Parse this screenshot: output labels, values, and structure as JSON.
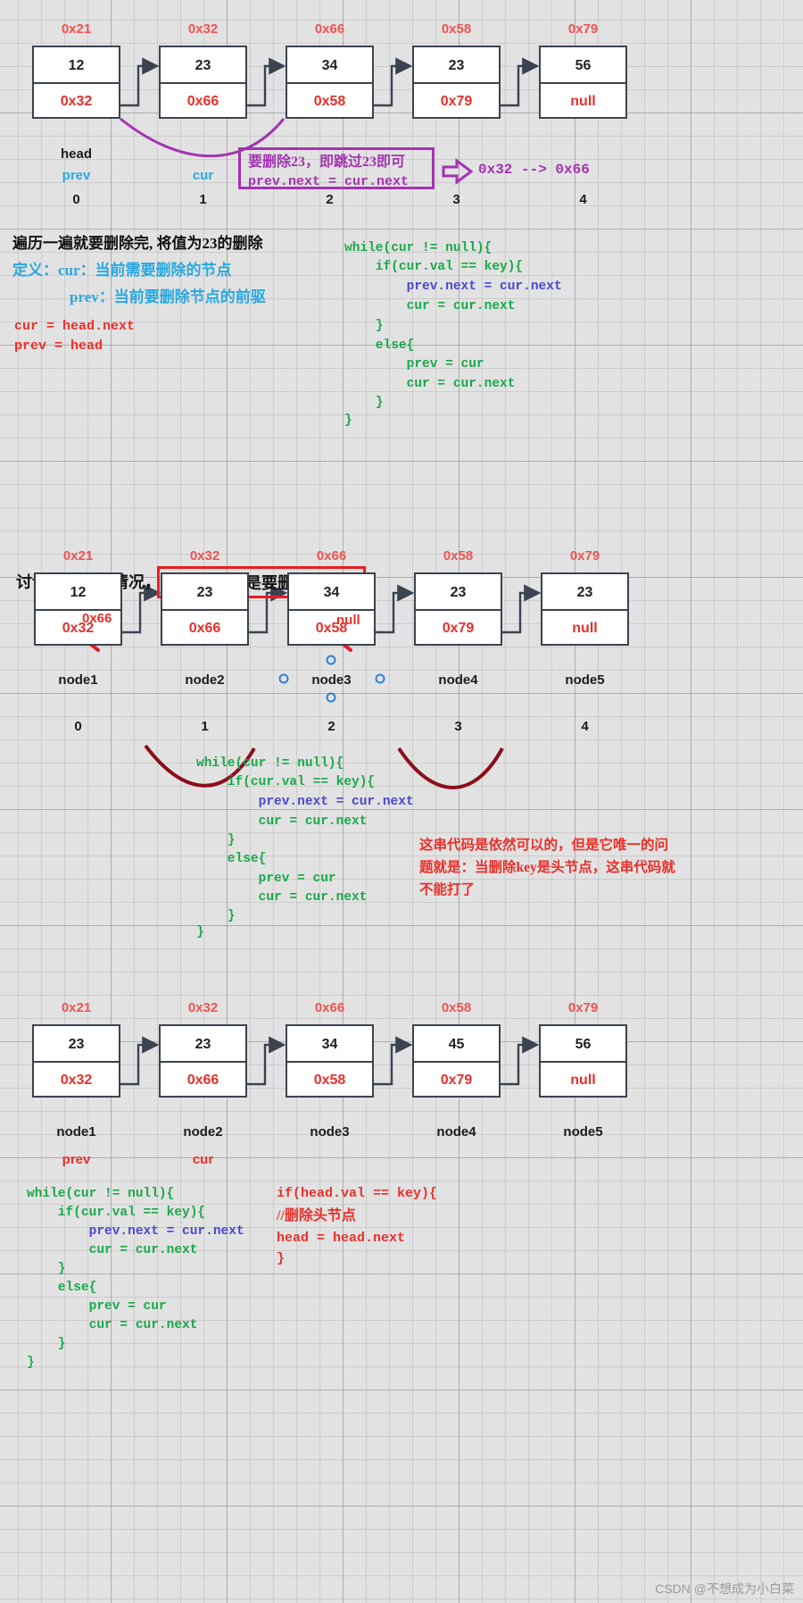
{
  "section1": {
    "addresses": [
      "0x21",
      "0x32",
      "0x66",
      "0x58",
      "0x79"
    ],
    "values": [
      "12",
      "23",
      "34",
      "23",
      "56"
    ],
    "pointers": [
      "0x32",
      "0x66",
      "0x58",
      "0x79",
      "null"
    ],
    "labels": [
      "head",
      "",
      "",
      "",
      ""
    ],
    "pointer_labels": [
      "prev",
      "",
      "cur",
      "",
      ""
    ],
    "indices": [
      "0",
      "1",
      "2",
      "3",
      "4"
    ],
    "callout_line1": "要删除23，即跳过23即可",
    "callout_line2": "prev.next = cur.next",
    "callout_result": "0x32 --> 0x66"
  },
  "explain1": {
    "title": "遍历一遍就要删除完, 将值为23的删除",
    "def_line1": "定义：cur：当前需要删除的节点",
    "def_line2": "prev：当前要删除节点的前驱",
    "init_line1": "cur = head.next",
    "init_line2": "prev = head"
  },
  "code1": {
    "lines": [
      "while(cur != null){",
      "    if(cur.val == key){",
      "        prev.next = cur.next",
      "        cur = cur.next",
      "    }",
      "    else{",
      "        prev = cur",
      "        cur = cur.next",
      "    }",
      "}"
    ],
    "highlight_line_index": 2
  },
  "section2": {
    "heading_prefix": "讨论另外一种情况，",
    "heading_boxed": "尾巴节点也是要删除的节点",
    "addresses": [
      "0x21",
      "0x32",
      "0x66",
      "0x58",
      "0x79"
    ],
    "values": [
      "12",
      "23",
      "34",
      "23",
      "23"
    ],
    "pointers": [
      "0x32",
      "0x66",
      "0x58",
      "0x79",
      "null"
    ],
    "strike_replacements": [
      "0x66",
      "",
      "null",
      "",
      ""
    ],
    "node_labels": [
      "node1",
      "node2",
      "node3",
      "node4",
      "node5"
    ],
    "indices": [
      "0",
      "1",
      "2",
      "3",
      "4"
    ]
  },
  "code2": {
    "lines": [
      "while(cur != null){",
      "    if(cur.val == key){",
      "        prev.next = cur.next",
      "        cur = cur.next",
      "    }",
      "    else{",
      "        prev = cur",
      "        cur = cur.next",
      "    }",
      "}"
    ],
    "highlight_line_index": 2,
    "note": "这串代码是依然可以的，但是它唯一的问题就是：当删除key是头节点，这串代码就不能打了"
  },
  "section3": {
    "addresses": [
      "0x21",
      "0x32",
      "0x66",
      "0x58",
      "0x79"
    ],
    "values": [
      "23",
      "23",
      "34",
      "45",
      "56"
    ],
    "pointers": [
      "0x32",
      "0x66",
      "0x58",
      "0x79",
      "null"
    ],
    "node_labels": [
      "node1",
      "node2",
      "node3",
      "node4",
      "node5"
    ],
    "pointer_labels": [
      "prev",
      "cur",
      "",
      "",
      ""
    ]
  },
  "code3": {
    "lines": [
      "while(cur != null){",
      "    if(cur.val == key){",
      "        prev.next = cur.next",
      "        cur = cur.next",
      "    }",
      "    else{",
      "        prev = cur",
      "        cur = cur.next",
      "    }",
      "}"
    ],
    "highlight_line_index": 2
  },
  "code4": {
    "lines": [
      "if(head.val == key){",
      "//删除头节点",
      "head = head.next",
      "}"
    ]
  },
  "watermark": "CSDN @不想成为小白菜",
  "colors": {
    "address_red": "#ef5350",
    "pointer_red": "#e8302a",
    "blue": "#29a8e0",
    "purple": "#a333b0",
    "green": "#1aa84a",
    "code_highlight": "#4a48cf",
    "box_border": "#3b4350"
  }
}
